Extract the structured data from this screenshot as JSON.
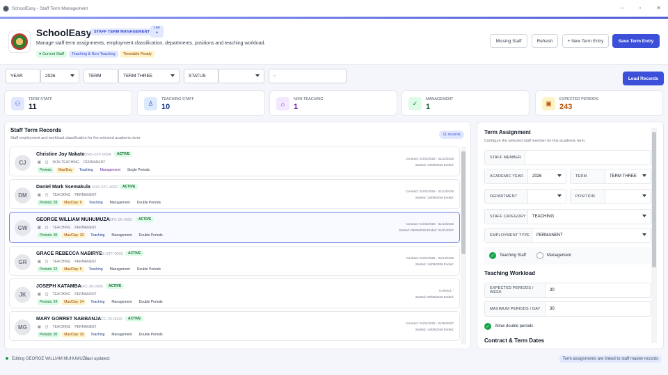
{
  "window": {
    "title": "SchoolEasy - Staff Term Management"
  },
  "header": {
    "app_name": "SchoolEasy",
    "badge": "STAFF TERM MANAGEMENT",
    "live": "Live",
    "subtitle": "Manage staff term assignments, employment classification, departments, positions and teaching workload.",
    "chips": [
      "● Current Staff",
      "Teaching & Non-Teaching",
      "Timetable Ready"
    ],
    "buttons": {
      "missing": "Missing Staff",
      "refresh": "Refresh",
      "new": "+ New Term Entry",
      "save": "Save Term Entry"
    }
  },
  "filters": {
    "year_label": "YEAR",
    "year_value": "2026",
    "term_label": "TERM",
    "term_value": "TERM THREE",
    "status_label": "STATUS",
    "status_value": "",
    "search_placeholder": "",
    "load": "Load Records"
  },
  "stats": [
    {
      "label": "TERM STAFF",
      "value": "11",
      "color": "#111827"
    },
    {
      "label": "TEACHING STAFF",
      "value": "10",
      "color": "#1e3a8a"
    },
    {
      "label": "NON-TEACHING",
      "value": "1",
      "color": "#6b21a8"
    },
    {
      "label": "MANAGEMENT",
      "value": "1",
      "color": "#166534"
    },
    {
      "label": "EXPECTED PERIODS",
      "value": "243",
      "color": "#b45309"
    }
  ],
  "records": {
    "title": "Staff Term Records",
    "subtitle": "Staff employment and workload classification for the selected academic term.",
    "count": "11 records",
    "items": [
      {
        "initials": "CJ",
        "name": "Christine Joy Nakato",
        "id": "VHS-STF-0004",
        "status": "ACTIVE",
        "category": "NON-TEACHING",
        "employment": "PERMANENT",
        "periods": "Periods",
        "maxday": "Max/Day",
        "teaching": "Teaching",
        "mgmt": "Management",
        "dbl": "Single Periods",
        "contract": "Contract: 01/01/2026 - 31/12/2026",
        "started": "Started: 14/09/2026 Ended:"
      },
      {
        "initials": "DM",
        "name": "Daniel Mark Ssemakula",
        "id": "VHS-STF-0001",
        "status": "ACTIVE",
        "category": "TEACHING",
        "employment": "PERMANENT",
        "periods": "Periods: 28",
        "maxday": "Max/Day: 6",
        "teaching": "Teaching",
        "mgmt": "Management",
        "dbl": "Double Periods",
        "contract": "Contract: 01/01/2026 - 31/12/2026",
        "started": "Started: 14/09/2026 Ended:"
      },
      {
        "initials": "GW",
        "name": "GEORGE WILLIAM MUHUMUZA",
        "id": "SFC-26-0002",
        "status": "ACTIVE",
        "category": "TEACHING",
        "employment": "PERMANENT",
        "periods": "Periods: 30",
        "maxday": "Max/Day: 30",
        "teaching": "Teaching",
        "mgmt": "Management",
        "dbl": "Double Periods",
        "contract": "Contract: 01/06/2026 - 31/12/2026",
        "started": "Started: 08/09/2026 Ended: 01/01/2027"
      },
      {
        "initials": "GR",
        "name": "GRACE REBECCA NABIRYE",
        "id": "VHS-STF-0002",
        "status": "ACTIVE",
        "category": "TEACHING",
        "employment": "PERMANENT",
        "periods": "Periods: 22",
        "maxday": "Max/Day: 5",
        "teaching": "Teaching",
        "mgmt": "Management",
        "dbl": "Double Periods",
        "contract": "Contract: 01/01/2026 - 31/12/2026",
        "started": "Started: 14/09/2026 Ended:"
      },
      {
        "initials": "JK",
        "name": "JOSEPH KATAMBA",
        "id": "SFC-26-0005",
        "status": "ACTIVE",
        "category": "TEACHING",
        "employment": "PERMANENT",
        "periods": "Periods: 24",
        "maxday": "Max/Day: 24",
        "teaching": "Teaching",
        "mgmt": "Management",
        "dbl": "Double Periods",
        "contract": "Contract: -",
        "started": "Started: 09/09/2026 Ended:"
      },
      {
        "initials": "MG",
        "name": "MARY GORRET NABBANJA",
        "id": "SFC-26-0003",
        "status": "ACTIVE",
        "category": "TEACHING",
        "employment": "PERMANENT",
        "periods": "Periods: 30",
        "maxday": "Max/Day: 30",
        "teaching": "Teaching",
        "mgmt": "Management",
        "dbl": "Double Periods",
        "contract": "Contract: 01/01/2026 - 01/06/2027",
        "started": "Started: 14/09/2026 Ended:"
      }
    ]
  },
  "assignment": {
    "title": "Term Assignment",
    "subtitle": "Configure the selected staff member for this academic term.",
    "staff_member": "STAFF MEMBER",
    "academic_year": "ACADEMIC YEAR",
    "year_value": "2026",
    "term": "TERM",
    "term_value": "TERM THREE",
    "department": "DEPARTMENT",
    "position": "POSITION",
    "staff_category": "STAFF CATEGORY",
    "category_value": "TEACHING",
    "employment_type": "EMPLOYMENT TYPE",
    "employment_value": "PERMANENT",
    "teaching_staff": "Teaching Staff",
    "management": "Management",
    "workload_title": "Teaching Workload",
    "exp_periods": "EXPECTED PERIODS / WEEK",
    "exp_value": "30",
    "max_periods": "MAXIMUM PERIODS / DAY",
    "max_value": "30",
    "allow_double": "Allow double periods",
    "contract_title": "Contract & Term Dates"
  },
  "footer": {
    "editing": "Editing GEORGE WILLIAM MUHUMUZA.",
    "updated": "Last updated:",
    "note": "Term assignments are linked to staff master records"
  }
}
